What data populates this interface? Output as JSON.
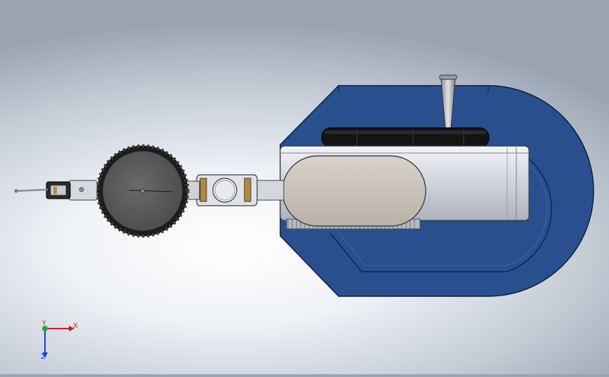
{
  "viewport": {
    "background_colors": [
      "#9aa4b1",
      "#ffffff"
    ],
    "model_colors": {
      "base": "#2a4f8e",
      "body": "#d9dde4",
      "dial": "#565656",
      "knob": "#141414",
      "pad": "#c9c2b9",
      "brass": "#b08a3a"
    }
  },
  "triad": {
    "x_label": "X",
    "y_label": "Y",
    "z_label": "Z",
    "x_color": "#d11a1a",
    "y_color": "#1fae2a",
    "z_color": "#1a3fd1"
  }
}
